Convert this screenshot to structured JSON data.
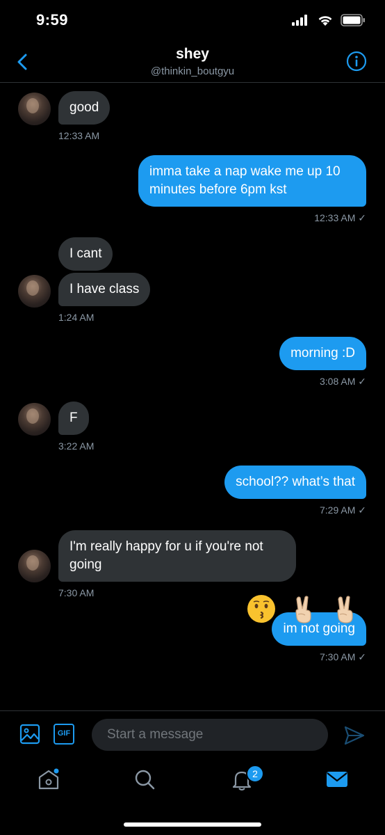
{
  "status_bar": {
    "time": "9:59"
  },
  "header": {
    "title": "shey",
    "handle": "@thinkin_boutgyu"
  },
  "messages": [
    {
      "dir": "in",
      "text": "good"
    },
    {
      "dir": "in_ts",
      "text": "12:33 AM"
    },
    {
      "dir": "out",
      "text": "imma take a nap wake me up 10 minutes before 6pm kst"
    },
    {
      "dir": "out_ts",
      "text": "12:33 AM ✓"
    },
    {
      "dir": "in",
      "text": "I cant"
    },
    {
      "dir": "in",
      "text": "I have class"
    },
    {
      "dir": "in_ts",
      "text": "1:24 AM"
    },
    {
      "dir": "out",
      "text": "morning :D"
    },
    {
      "dir": "out_ts",
      "text": "3:08 AM ✓"
    },
    {
      "dir": "in",
      "text": "F"
    },
    {
      "dir": "in_ts",
      "text": "3:22 AM"
    },
    {
      "dir": "out",
      "text": "school?? what’s that"
    },
    {
      "dir": "out_ts",
      "text": "7:29 AM ✓"
    },
    {
      "dir": "in",
      "text": "I'm really happy for u if you're not going"
    },
    {
      "dir": "in_ts",
      "text": "7:30 AM"
    },
    {
      "dir": "out",
      "text": "im not going"
    },
    {
      "dir": "out_ts",
      "text": "7:30 AM ✓"
    }
  ],
  "emoji_reply": [
    "kissing-face-emoji",
    "victory-hand-emoji",
    "victory-hand-emoji"
  ],
  "composer": {
    "placeholder": "Start a message",
    "gif_label": "GIF"
  },
  "tabbar": {
    "notifications_badge": "2"
  },
  "colors": {
    "accent": "#1d9bf0",
    "incoming_bubble": "#2f3336",
    "background": "#000000"
  }
}
